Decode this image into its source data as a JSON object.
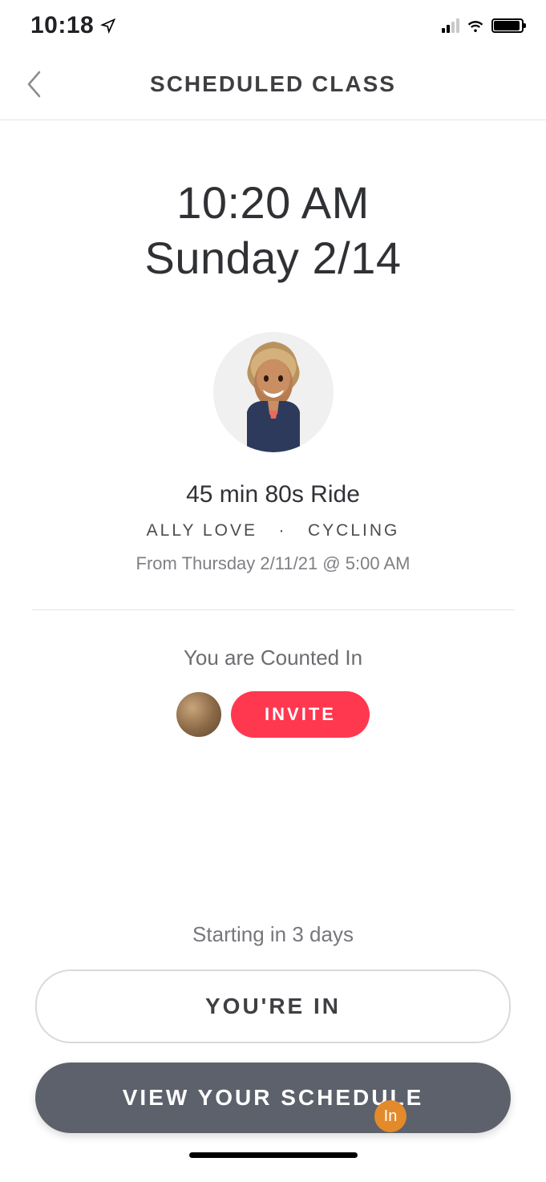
{
  "status": {
    "time": "10:18"
  },
  "header": {
    "title": "SCHEDULED CLASS"
  },
  "schedule": {
    "time": "10:20 AM",
    "date": "Sunday 2/14"
  },
  "class": {
    "title": "45 min 80s Ride",
    "instructor": "ALLY LOVE",
    "separator": "·",
    "category": "CYCLING",
    "origin": "From Thursday 2/11/21 @ 5:00 AM"
  },
  "counted": {
    "label": "You are Counted In",
    "invite_label": "INVITE"
  },
  "footer": {
    "starting": "Starting in 3 days",
    "you_in": "YOU'RE IN",
    "view_schedule": "VIEW YOUR SCHEDULE"
  },
  "badge": {
    "text": "In"
  }
}
